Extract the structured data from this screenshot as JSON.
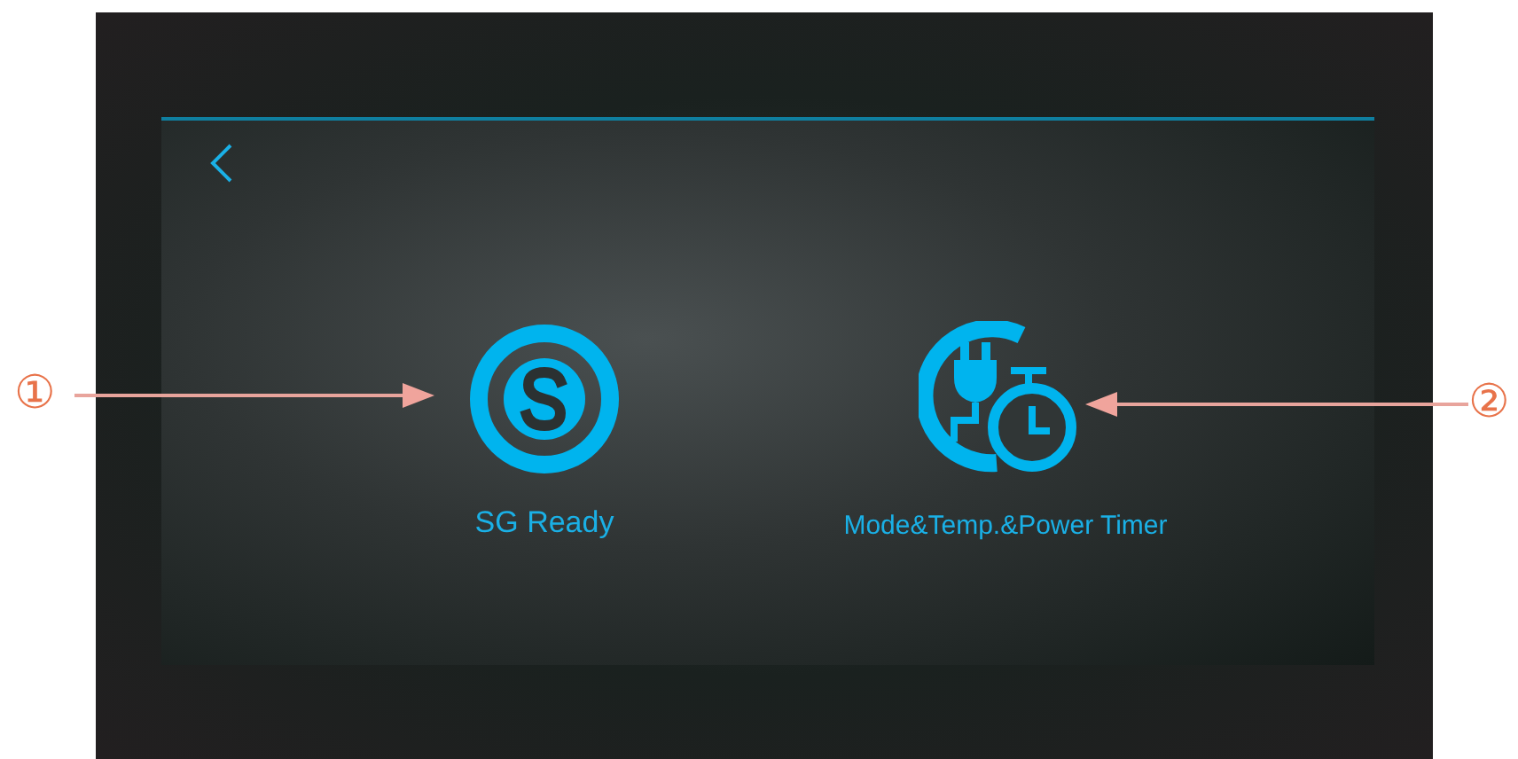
{
  "screen": {
    "items": [
      {
        "kind": "sg",
        "label": "SG Ready"
      },
      {
        "kind": "timer",
        "label": "Mode&Temp.&Power Timer"
      }
    ]
  },
  "callouts": [
    {
      "kind": "left",
      "number": "①"
    },
    {
      "kind": "right",
      "number": "②"
    }
  ]
}
